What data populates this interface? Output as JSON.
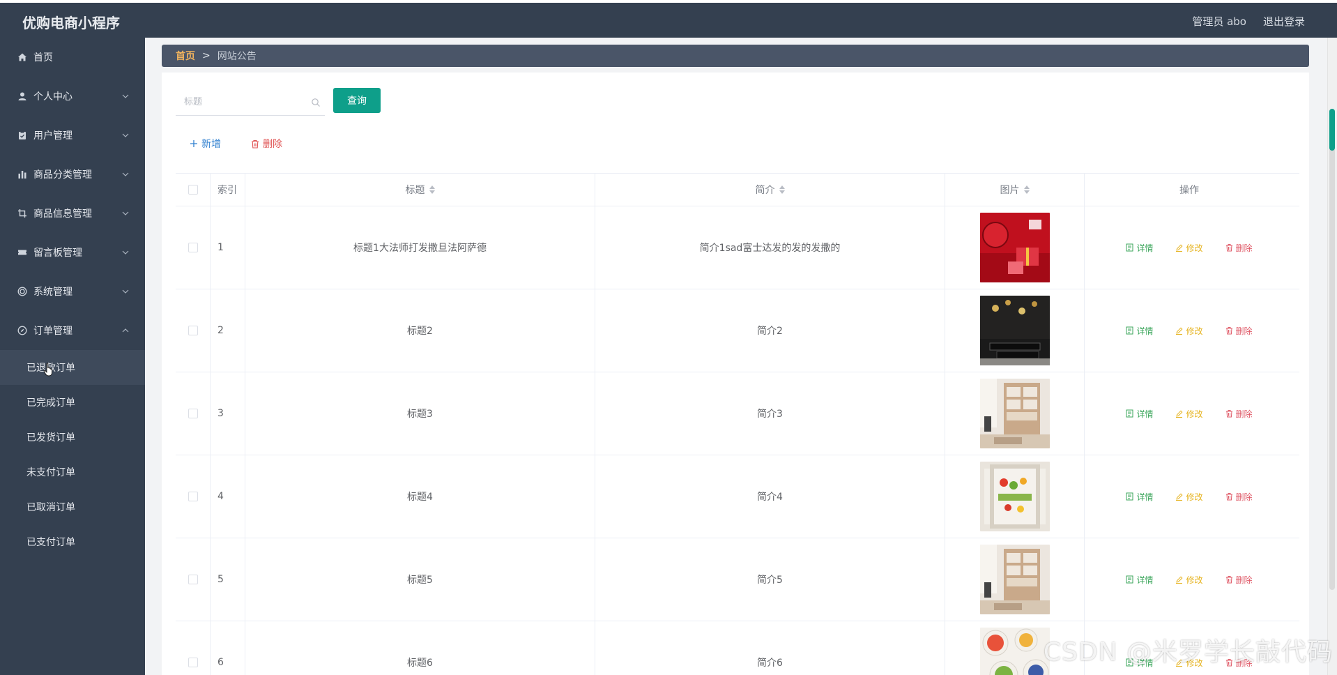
{
  "app": {
    "title": "优购电商小程序"
  },
  "header": {
    "admin_label": "管理员 abo",
    "logout_label": "退出登录"
  },
  "sidebar": {
    "items": [
      {
        "label": "首页",
        "icon": "home-icon",
        "expandable": false
      },
      {
        "label": "个人中心",
        "icon": "user-icon",
        "expandable": true
      },
      {
        "label": "用户管理",
        "icon": "clipboard-icon",
        "expandable": true
      },
      {
        "label": "商品分类管理",
        "icon": "bar-chart-icon",
        "expandable": true
      },
      {
        "label": "商品信息管理",
        "icon": "crop-icon",
        "expandable": true
      },
      {
        "label": "留言板管理",
        "icon": "ticket-icon",
        "expandable": true
      },
      {
        "label": "系统管理",
        "icon": "circle-icon",
        "expandable": true
      },
      {
        "label": "订单管理",
        "icon": "compass-icon",
        "expandable": true,
        "expanded": true
      }
    ],
    "order_sub": [
      "已退款订单",
      "已完成订单",
      "已发货订单",
      "未支付订单",
      "已取消订单",
      "已支付订单"
    ]
  },
  "breadcrumb": {
    "home": "首页",
    "sep": ">",
    "current": "网站公告"
  },
  "search": {
    "placeholder": "标题",
    "value": "",
    "button": "查询"
  },
  "actions": {
    "add": "新增",
    "delete": "删除"
  },
  "table": {
    "headers": {
      "index": "索引",
      "title": "标题",
      "intro": "简介",
      "image": "图片",
      "ops": "操作"
    },
    "rows": [
      {
        "index": "1",
        "title": "标题1大法师打发撒旦法阿萨德",
        "intro": "简介1sad富士达发的发的发撒的",
        "image": "red-gift-box"
      },
      {
        "index": "2",
        "title": "标题2",
        "intro": "简介2",
        "image": "black-shelf"
      },
      {
        "index": "3",
        "title": "标题3",
        "intro": "简介3",
        "image": "wood-bookshelf"
      },
      {
        "index": "4",
        "title": "标题4",
        "intro": "简介4",
        "image": "fridge"
      },
      {
        "index": "5",
        "title": "标题5",
        "intro": "简介5",
        "image": "wood-bookshelf"
      },
      {
        "index": "6",
        "title": "标题6",
        "intro": "简介6",
        "image": "fruit-bowls"
      }
    ],
    "ops": {
      "detail": "详情",
      "edit": "修改",
      "remove": "删除"
    }
  },
  "watermark": "CSDN @米罗学长敲代码",
  "colors": {
    "header_bg": "#344050",
    "accent": "#0e9f8a",
    "breadcrumb_home": "#f0b35e"
  }
}
